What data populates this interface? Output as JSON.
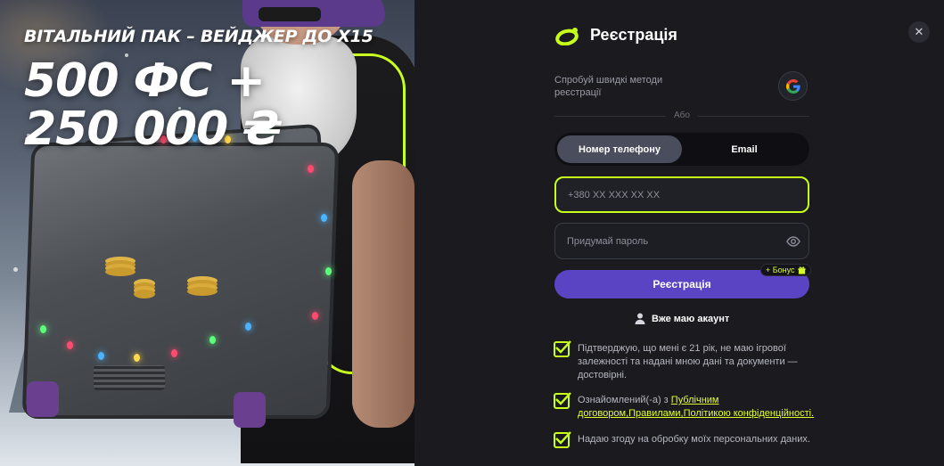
{
  "promo": {
    "subtitle": "ВІТАЛЬНИЙ ПАК – ВЕЙДЖЕР ДО Х15",
    "title": "500 ФС + 250 000 ₴"
  },
  "modal": {
    "title": "Реєстрація",
    "close_label": "✕",
    "quick_methods_text": "Спробуй швидкі методи реєстрації",
    "or_label": "Або",
    "tabs": [
      {
        "label": "Номер телефону",
        "active": true
      },
      {
        "label": "Email",
        "active": false
      }
    ],
    "phone_placeholder": "+380 XX XXX XX XX",
    "password_placeholder": "Придумай пароль",
    "submit_label": "Реєстрація",
    "bonus_badge": "+ Бонус",
    "have_account_label": "Вже маю акаунт",
    "consents": [
      {
        "text": "Підтверджую, що мені є 21 рік, не маю ігрової залежності та надані мною дані та документи — достовірні.",
        "checked": true
      },
      {
        "prefix": "Ознайомлений(-а) з ",
        "link1": "Публічним договором",
        "sep1": ",",
        "link2": "Правилами",
        "sep2": ",",
        "link3": "Політикою конфіденційності",
        "suffix": ".",
        "checked": true
      },
      {
        "text": "Надаю згоду на обробку моїх персональних даних.",
        "checked": true
      }
    ]
  },
  "colors": {
    "accent": "#c7ff1a",
    "primary_button": "#5a44c4",
    "panel_bg": "#1a1a1f"
  }
}
